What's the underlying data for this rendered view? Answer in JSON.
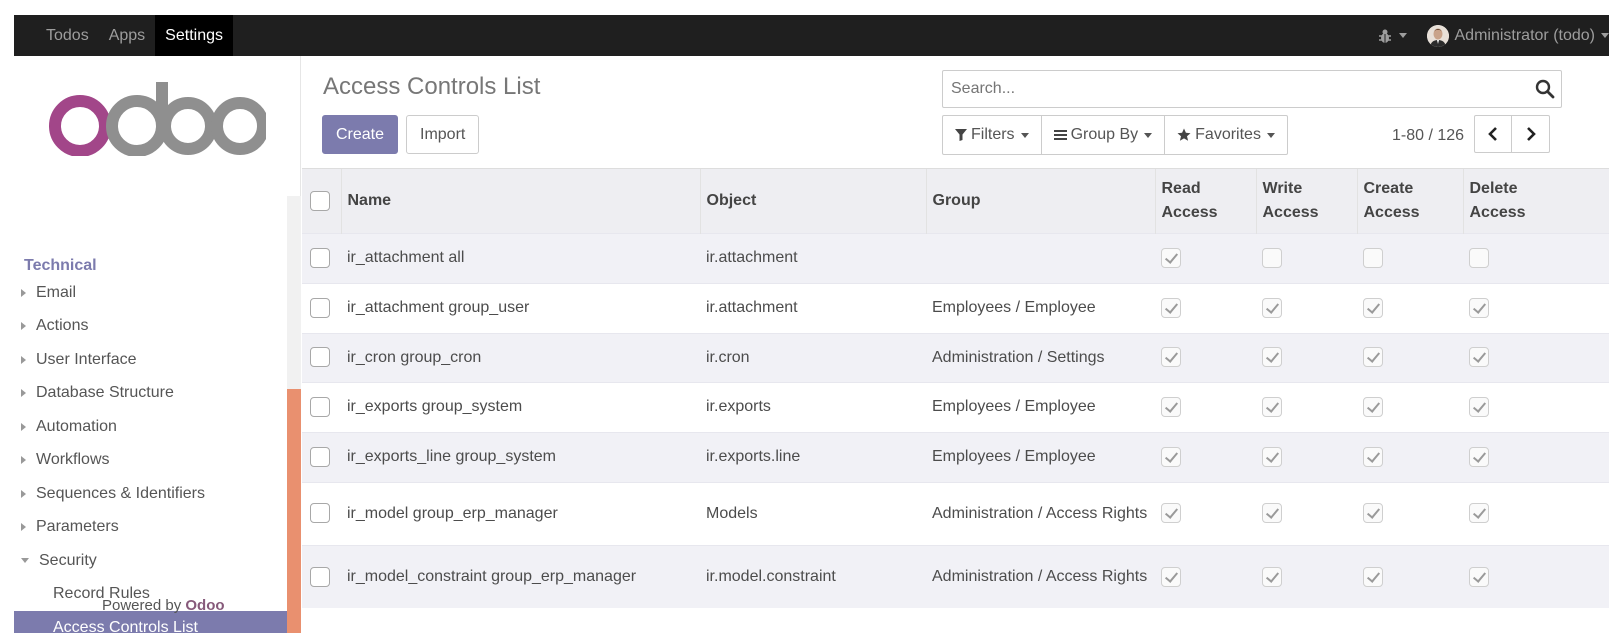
{
  "navbar": {
    "items": [
      {
        "label": "Todos",
        "active": false
      },
      {
        "label": "Apps",
        "active": false
      },
      {
        "label": "Settings",
        "active": true
      }
    ],
    "user": "Administrator (todo)"
  },
  "sidebar": {
    "brand": "odoo",
    "section": "Technical",
    "items": [
      {
        "label": "Email"
      },
      {
        "label": "Actions"
      },
      {
        "label": "User Interface"
      },
      {
        "label": "Database Structure"
      },
      {
        "label": "Automation"
      },
      {
        "label": "Workflows"
      },
      {
        "label": "Sequences & Identifiers"
      },
      {
        "label": "Parameters"
      },
      {
        "label": "Security"
      }
    ],
    "subitems": [
      {
        "label": "Record Rules",
        "active": false
      },
      {
        "label": "Access Controls List",
        "active": true
      }
    ],
    "powered_prefix": "Powered by",
    "powered_brand": "Odoo"
  },
  "control": {
    "title": "Access Controls List",
    "create_label": "Create",
    "import_label": "Import",
    "search_placeholder": "Search...",
    "filters_label": "Filters",
    "groupby_label": "Group By",
    "favorites_label": "Favorites",
    "pager": "1-80 / 126"
  },
  "table": {
    "headers": {
      "name": "Name",
      "object": "Object",
      "group": "Group",
      "read": [
        "Read",
        "Access"
      ],
      "write": [
        "Write",
        "Access"
      ],
      "create": [
        "Create",
        "Access"
      ],
      "delete": [
        "Delete",
        "Access"
      ]
    },
    "rows": [
      {
        "name": "ir_attachment all",
        "object": "ir.attachment",
        "group": "",
        "read": true,
        "write": false,
        "create": false,
        "delete": false
      },
      {
        "name": "ir_attachment group_user",
        "object": "ir.attachment",
        "group": "Employees / Employee",
        "read": true,
        "write": true,
        "create": true,
        "delete": true
      },
      {
        "name": "ir_cron group_cron",
        "object": "ir.cron",
        "group": "Administration / Settings",
        "read": true,
        "write": true,
        "create": true,
        "delete": true
      },
      {
        "name": "ir_exports group_system",
        "object": "ir.exports",
        "group": "Employees / Employee",
        "read": true,
        "write": true,
        "create": true,
        "delete": true
      },
      {
        "name": "ir_exports_line group_system",
        "object": "ir.exports.line",
        "group": "Employees / Employee",
        "read": true,
        "write": true,
        "create": true,
        "delete": true
      },
      {
        "name": "ir_model group_erp_manager",
        "object": "Models",
        "group": "Administration / Access Rights",
        "read": true,
        "write": true,
        "create": true,
        "delete": true
      },
      {
        "name": "ir_model_constraint group_erp_manager",
        "object": "ir.model.constraint",
        "group": "Administration / Access Rights",
        "read": true,
        "write": true,
        "create": true,
        "delete": true
      }
    ]
  },
  "colors": {
    "brand": "#7c7bad",
    "logo_o": "#a24689",
    "logo_doo": "#8f8f8f",
    "scroll_thumb": "#e9906f"
  }
}
